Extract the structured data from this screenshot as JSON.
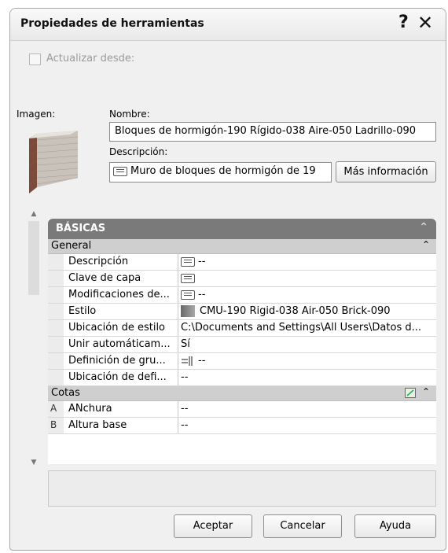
{
  "dialog": {
    "title": "Propiedades de herramientas",
    "help_label": "?",
    "close_label": "✕"
  },
  "update_from": {
    "label": "Actualizar desde:",
    "checked": false
  },
  "image_label": "Imagen:",
  "name": {
    "label": "Nombre:",
    "value": "Bloques de hormigón-190 Rígido-038 Aire-050 Ladrillo-090"
  },
  "description": {
    "label": "Descripción:",
    "value": "Muro de bloques de hormigón de 19",
    "more_button": "Más información"
  },
  "grid": {
    "header": "BÁSICAS",
    "categories": [
      {
        "name": "General",
        "rows": [
          {
            "name": "Descripción",
            "value": "--",
            "icon": "note-icon"
          },
          {
            "name": "Clave de capa",
            "value": "",
            "icon": "note-icon"
          },
          {
            "name": "Modificaciones de...",
            "value": "--",
            "icon": "note-icon"
          },
          {
            "name": "Estilo",
            "value": "CMU-190 Rigid-038 Air-050 Brick-090",
            "icon": "style-swatch-icon"
          },
          {
            "name": "Ubicación de estilo",
            "value": "C:\\Documents and Settings\\All Users\\Datos d...",
            "icon": ""
          },
          {
            "name": "Unir automáticam...",
            "value": "Sí",
            "icon": ""
          },
          {
            "name": "Definición de gru...",
            "value": "--",
            "icon": "cleanup-group-icon"
          },
          {
            "name": "Ubicación de defi...",
            "value": "--",
            "icon": ""
          }
        ]
      },
      {
        "name": "Cotas",
        "rows": [
          {
            "gutter": "A",
            "name": "ANchura",
            "value": "--",
            "icon": ""
          },
          {
            "gutter": "B",
            "name": "Altura base",
            "value": "--",
            "icon": ""
          }
        ]
      }
    ]
  },
  "buttons": {
    "ok": "Aceptar",
    "cancel": "Cancelar",
    "help": "Ayuda"
  }
}
